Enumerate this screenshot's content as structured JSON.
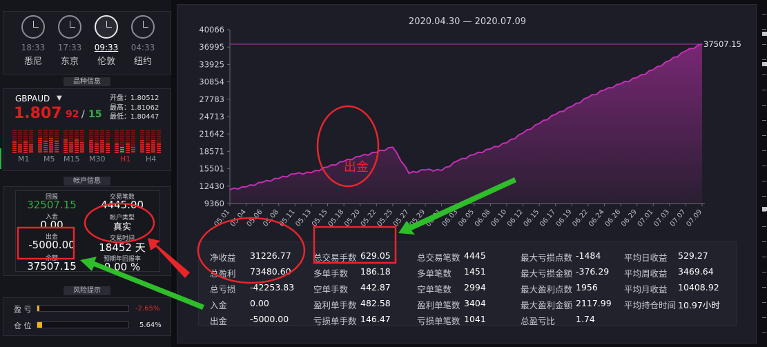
{
  "clocks": [
    {
      "time": "18:33",
      "city": "悉尼",
      "active": false
    },
    {
      "time": "17:33",
      "city": "东京",
      "active": false
    },
    {
      "time": "09:33",
      "city": "伦敦",
      "active": true
    },
    {
      "time": "04:33",
      "city": "纽约",
      "active": false
    }
  ],
  "sections": {
    "product": "品种信息",
    "account": "帐户信息",
    "risk": "风险提示"
  },
  "quote": {
    "symbol": "GBPAUD",
    "price_main": "1.807",
    "price_small": "92",
    "slash": "/",
    "price_ask": "15",
    "open": "开盘：1.80512",
    "high": "最高：1.81062",
    "low": "最低：1.80447"
  },
  "timeframes": [
    {
      "label": "M1",
      "active": false,
      "level": 0.45
    },
    {
      "label": "M5",
      "active": false,
      "level": 0.6
    },
    {
      "label": "M15",
      "active": false,
      "level": 0.55
    },
    {
      "label": "M30",
      "active": false,
      "level": 0.5
    },
    {
      "label": "H1",
      "active": true,
      "level": 0.35
    },
    {
      "label": "H4",
      "active": false,
      "level": 0.5
    }
  ],
  "account": {
    "profit_label": "回报",
    "profit": "32507.15",
    "trades_label": "交易笔数",
    "trades": "4445.00",
    "deposit_label": "入金",
    "deposit": "0.00",
    "type_label": "帐户类型",
    "type": "真实",
    "withdraw_label": "出金",
    "withdraw": "-5000.00",
    "time_label": "交易时间",
    "time": "18452 天",
    "balance_label": "余额",
    "balance": "37507.15",
    "annual_label": "预期年回报率",
    "annual": "0.00 %"
  },
  "risk": {
    "pl_label": "盈 亏",
    "pl_pct": "-2.65%",
    "pl_level": 0.02,
    "pos_label": "仓 位",
    "pos_pct": "5.64%",
    "pos_level": 0.056
  },
  "chart_data": {
    "type": "area",
    "title": "2020.04.30 — 2020.07.09",
    "end_label": "37507.15",
    "ylim": [
      9360,
      40066
    ],
    "yticks": [
      "40066",
      "36995",
      "33925",
      "30854",
      "27783",
      "24713",
      "21642",
      "18571",
      "15501",
      "12430",
      "9360"
    ],
    "xticks": [
      "05.01",
      "05.04",
      "05.06",
      "05.08",
      "05.11",
      "05.13",
      "05.15",
      "05.18",
      "05.20",
      "05.22",
      "05.25",
      "05.27",
      "05.29",
      "06.01",
      "06.03",
      "06.05",
      "06.08",
      "06.10",
      "06.12",
      "06.15",
      "06.17",
      "06.19",
      "06.22",
      "06.24",
      "06.26",
      "06.29",
      "07.01",
      "07.03",
      "07.07",
      "07.09"
    ],
    "values": [
      11800,
      12300,
      13100,
      13800,
      14600,
      14800,
      15800,
      16800,
      17700,
      18400,
      19300,
      14700,
      15300,
      15200,
      16900,
      18000,
      19000,
      20100,
      21800,
      23500,
      25100,
      26500,
      28100,
      29400,
      30500,
      31600,
      33000,
      34600,
      36300,
      37507
    ],
    "series_color": "#c42fb4",
    "grid": false,
    "max_line": true
  },
  "annotation": {
    "withdraw_note": "出金"
  },
  "stats": [
    {
      "label": "净收益",
      "value": "31226.77"
    },
    {
      "label": "总盈利",
      "value": "73480.60"
    },
    {
      "label": "总亏损",
      "value": "-42253.83"
    },
    {
      "label": "入金",
      "value": "0.00"
    },
    {
      "label": "出金",
      "value": "-5000.00"
    },
    {
      "label": "总交易手数",
      "value": "629.05"
    },
    {
      "label": "多单手数",
      "value": "186.18"
    },
    {
      "label": "空单手数",
      "value": "442.87"
    },
    {
      "label": "盈利单手数",
      "value": "482.58"
    },
    {
      "label": "亏损单手数",
      "value": "146.47"
    },
    {
      "label": "总交易笔数",
      "value": "4445"
    },
    {
      "label": "多单笔数",
      "value": "1451"
    },
    {
      "label": "空单笔数",
      "value": "2994"
    },
    {
      "label": "盈利单笔数",
      "value": "3404"
    },
    {
      "label": "亏损单笔数",
      "value": "1041"
    },
    {
      "label": "最大亏损点数",
      "value": "-1484"
    },
    {
      "label": "最大亏损金额",
      "value": "-376.29"
    },
    {
      "label": "最大盈利点数",
      "value": "1956"
    },
    {
      "label": "最大盈利金额",
      "value": "2117.99"
    },
    {
      "label": "总盈亏比",
      "value": "1.74"
    },
    {
      "label": "平均日收益",
      "value": "529.27"
    },
    {
      "label": "平均周收益",
      "value": "3469.64"
    },
    {
      "label": "平均月收益",
      "value": "10408.92"
    },
    {
      "label": "平均持仓时间",
      "value": "10.97小时"
    }
  ]
}
